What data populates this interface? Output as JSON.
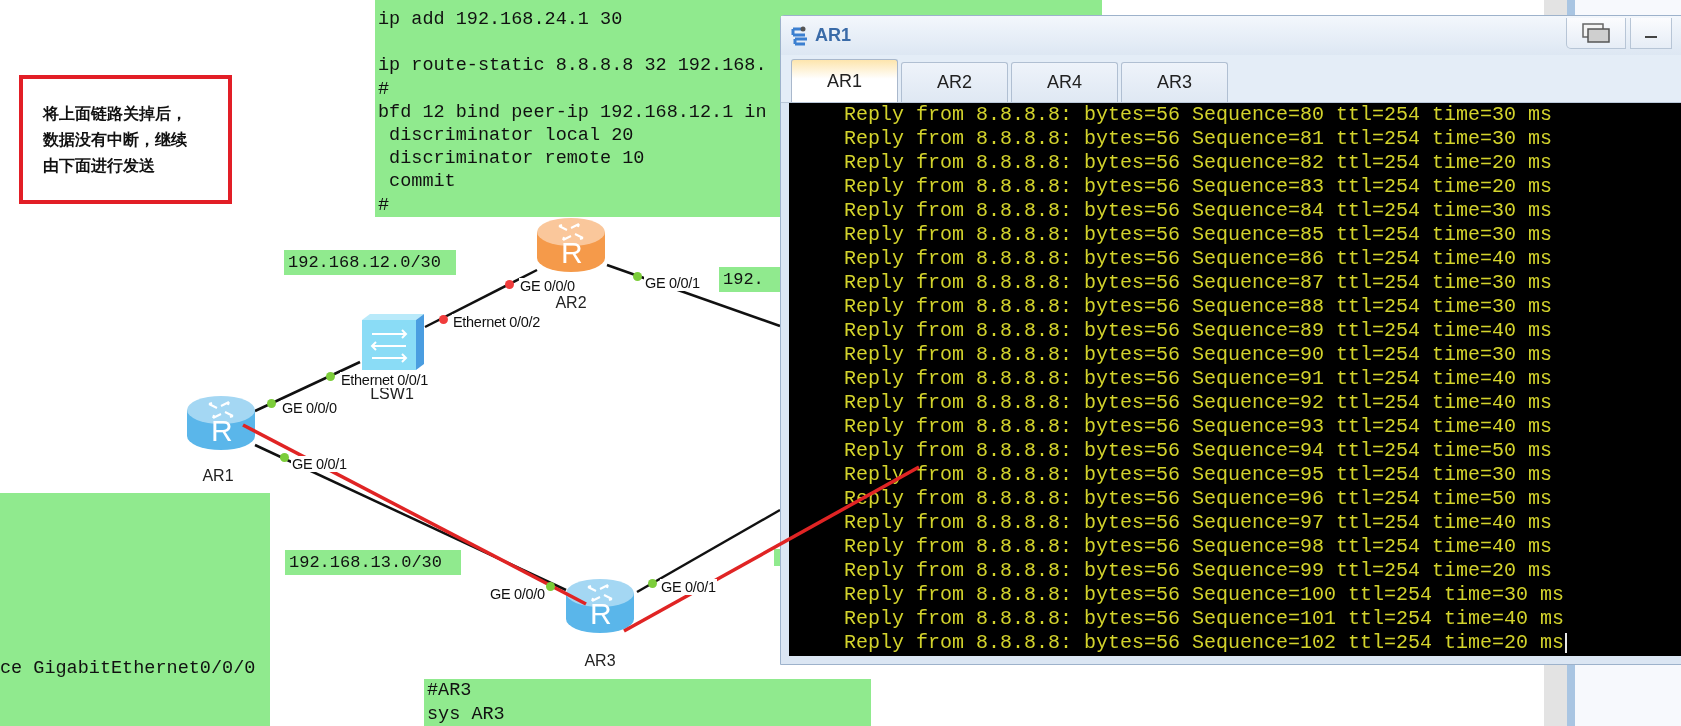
{
  "callout": {
    "text": "将上面链路关掉后，数据没有中断，继续由下面进行发送"
  },
  "config_blocks": [
    {
      "paragraphs": [
        [
          "ip add 192.168.24.1 30"
        ],
        [
          "ip route-static 8.8.8.8 32 192.168.",
          "#",
          "bfd 12 bind peer-ip 192.168.12.1 in",
          " discriminator local 20",
          " discriminator remote 10",
          " commit",
          "#"
        ]
      ]
    },
    {
      "paragraphs": [
        [
          "ce GigabitEthernet0/0/0"
        ]
      ]
    },
    {
      "paragraphs": [
        [
          "#AR3",
          "sys AR3"
        ]
      ]
    }
  ],
  "subnet_labels": [
    "192.168.12.0/30",
    "192.",
    "192.168.13.0/30"
  ],
  "devices": [
    {
      "name": "AR1",
      "kind": "router",
      "color": "#5ab6ea",
      "badge": "R"
    },
    {
      "name": "LSW1",
      "kind": "switch",
      "color": "#8adcf6"
    },
    {
      "name": "AR2",
      "kind": "router",
      "color": "#f59a4a",
      "badge": "R"
    },
    {
      "name": "AR3",
      "kind": "router",
      "color": "#5ab6ea",
      "badge": "R"
    }
  ],
  "links": [
    {
      "ports": [
        {
          "label": "GE 0/0/0",
          "color": "#7ccd3a"
        },
        {
          "label": "Ethernet 0/0/1",
          "color": "#7ccd3a"
        }
      ]
    },
    {
      "ports": [
        {
          "label": "Ethernet 0/0/2",
          "color": "#f03c3c"
        },
        {
          "label": "GE 0/0/0",
          "color": "#f03c3c"
        }
      ]
    },
    {
      "ports": [
        {
          "label": "GE 0/0/1",
          "color": "#7ccd3a"
        }
      ]
    },
    {
      "ports": [
        {
          "label": "GE 0/0/1",
          "color": "#7ccd3a"
        },
        {
          "label": "GE 0/0/0",
          "color": "#7ccd3a"
        }
      ]
    },
    {
      "ports": [
        {
          "label": "GE 0/0/1",
          "color": "#7ccd3a"
        }
      ]
    }
  ],
  "terminal_window": {
    "title": "AR1",
    "tabs": [
      {
        "label": "AR1",
        "selected": true
      },
      {
        "label": "AR2",
        "selected": false
      },
      {
        "label": "AR4",
        "selected": false
      },
      {
        "label": "AR3",
        "selected": false
      }
    ],
    "lines": [
      "Reply from 8.8.8.8: bytes=56 Sequence=80 ttl=254 time=30 ms",
      "Reply from 8.8.8.8: bytes=56 Sequence=81 ttl=254 time=30 ms",
      "Reply from 8.8.8.8: bytes=56 Sequence=82 ttl=254 time=20 ms",
      "Reply from 8.8.8.8: bytes=56 Sequence=83 ttl=254 time=20 ms",
      "Reply from 8.8.8.8: bytes=56 Sequence=84 ttl=254 time=30 ms",
      "Reply from 8.8.8.8: bytes=56 Sequence=85 ttl=254 time=30 ms",
      "Reply from 8.8.8.8: bytes=56 Sequence=86 ttl=254 time=40 ms",
      "Reply from 8.8.8.8: bytes=56 Sequence=87 ttl=254 time=30 ms",
      "Reply from 8.8.8.8: bytes=56 Sequence=88 ttl=254 time=30 ms",
      "Reply from 8.8.8.8: bytes=56 Sequence=89 ttl=254 time=40 ms",
      "Reply from 8.8.8.8: bytes=56 Sequence=90 ttl=254 time=30 ms",
      "Reply from 8.8.8.8: bytes=56 Sequence=91 ttl=254 time=40 ms",
      "Reply from 8.8.8.8: bytes=56 Sequence=92 ttl=254 time=40 ms",
      "Reply from 8.8.8.8: bytes=56 Sequence=93 ttl=254 time=40 ms",
      "Reply from 8.8.8.8: bytes=56 Sequence=94 ttl=254 time=50 ms",
      "Reply from 8.8.8.8: bytes=56 Sequence=95 ttl=254 time=30 ms",
      "Reply from 8.8.8.8: bytes=56 Sequence=96 ttl=254 time=50 ms",
      "Reply from 8.8.8.8: bytes=56 Sequence=97 ttl=254 time=40 ms",
      "Reply from 8.8.8.8: bytes=56 Sequence=98 ttl=254 time=40 ms",
      "Reply from 8.8.8.8: bytes=56 Sequence=99 ttl=254 time=20 ms",
      "Reply from 8.8.8.8: bytes=56 Sequence=100 ttl=254 time=30 ms",
      "Reply from 8.8.8.8: bytes=56 Sequence=101 ttl=254 time=40 ms",
      "Reply from 8.8.8.8: bytes=56 Sequence=102 ttl=254 time=20 ms"
    ]
  }
}
